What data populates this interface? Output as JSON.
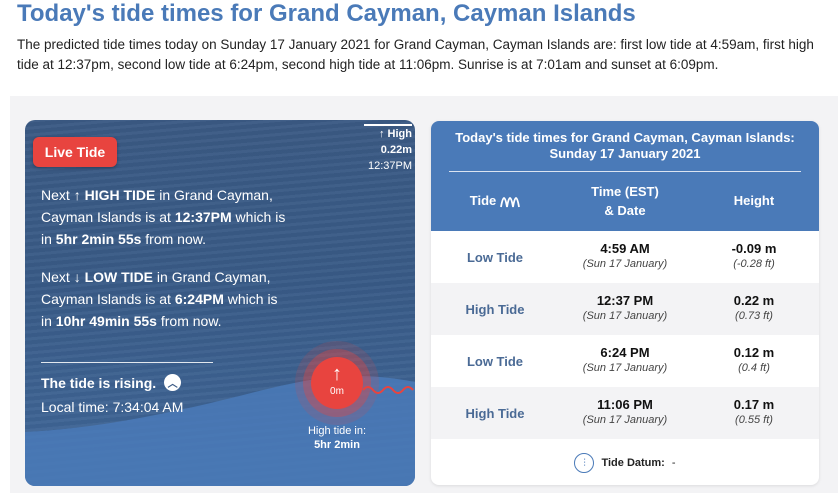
{
  "page": {
    "title": "Today's tide times for Grand Cayman, Cayman Islands",
    "intro": "The predicted tide times today on Sunday 17 January 2021 for Grand Cayman, Cayman Islands are: first low tide at 4:59am, first high tide at 12:37pm, second low tide at 6:24pm, second high tide at 11:06pm. Sunrise is at 7:01am and sunset at 6:09pm."
  },
  "live": {
    "badge": "Live Tide",
    "high_marker": {
      "arrow": "↑",
      "label": "High",
      "height": "0.22m",
      "time": "12:37PM"
    },
    "next_high": {
      "prefix": "Next",
      "arrow": "↑",
      "type": "HIGH TIDE",
      "mid": "in Grand Cayman, Cayman Islands is at",
      "time": "12:37PM",
      "which": "which is in",
      "countdown": "5hr 2min 55s",
      "suffix": "from now."
    },
    "next_low": {
      "prefix": "Next",
      "arrow": "↓",
      "type": "LOW TIDE",
      "mid": "in Grand Cayman, Cayman Islands is at",
      "time": "6:24PM",
      "which": "which is in",
      "countdown": "10hr 49min 55s",
      "suffix": "from now."
    },
    "status": "The tide is rising.",
    "status_icon": "chevron-up-circle-icon",
    "local_time_label": "Local time:",
    "local_time": "7:34:04 AM",
    "bubble": {
      "arrow": "↑",
      "level": "0m"
    },
    "high_in_label": "High tide in:",
    "high_in_value": "5hr 2min",
    "colors": {
      "badge": "#e8443f",
      "card": "#3b5a84"
    }
  },
  "table": {
    "title_line1": "Today's tide times for Grand Cayman, Cayman Islands:",
    "title_line2": "Sunday 17 January 2021",
    "col_tide": "Tide",
    "col_tide_icon": "wave-icon",
    "col_time_line1": "Time (EST)",
    "col_time_line2": "& Date",
    "col_height": "Height",
    "rows": [
      {
        "tide": "Low Tide",
        "time": "4:59 AM",
        "date": "(Sun 17 January)",
        "height_m": "-0.09 m",
        "height_ft": "(-0.28 ft)"
      },
      {
        "tide": "High Tide",
        "time": "12:37 PM",
        "date": "(Sun 17 January)",
        "height_m": "0.22 m",
        "height_ft": "(0.73 ft)"
      },
      {
        "tide": "Low Tide",
        "time": "6:24 PM",
        "date": "(Sun 17 January)",
        "height_m": "0.12 m",
        "height_ft": "(0.4 ft)"
      },
      {
        "tide": "High Tide",
        "time": "11:06 PM",
        "date": "(Sun 17 January)",
        "height_m": "0.17 m",
        "height_ft": "(0.55 ft)"
      }
    ],
    "datum_label": "Tide Datum:",
    "datum_value": "-",
    "datum_icon": "datum-icon",
    "colors": {
      "header": "#4a7ab8",
      "tide_text": "#4a6a95"
    }
  }
}
